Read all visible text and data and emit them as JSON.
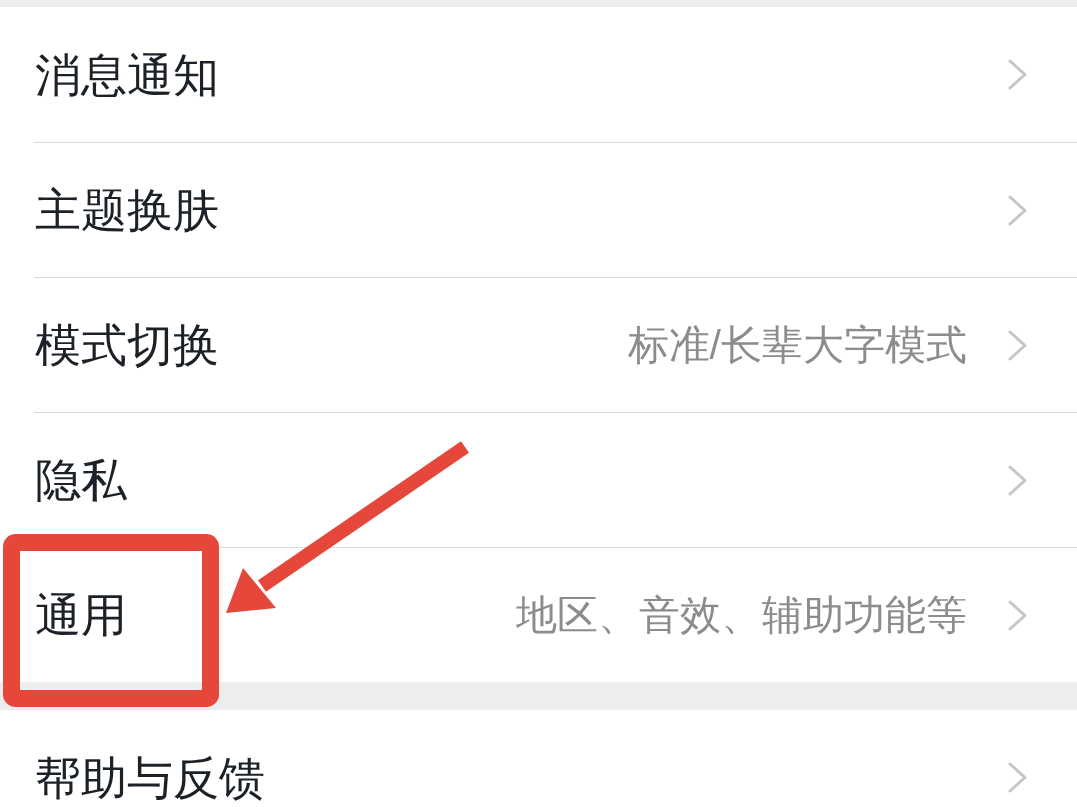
{
  "groups": [
    {
      "items": [
        {
          "label": "消息通知",
          "annotated": false
        },
        {
          "label": "主题换肤",
          "annotated": false
        },
        {
          "label": "模式切换",
          "value": "标准/长辈大字模式",
          "annotated": false
        },
        {
          "label": "隐私",
          "annotated": false
        },
        {
          "label": "通用",
          "value": "地区、音效、辅助功能等",
          "annotated": true
        }
      ]
    },
    {
      "items": [
        {
          "label": "帮助与反馈",
          "annotated": false
        }
      ]
    }
  ]
}
